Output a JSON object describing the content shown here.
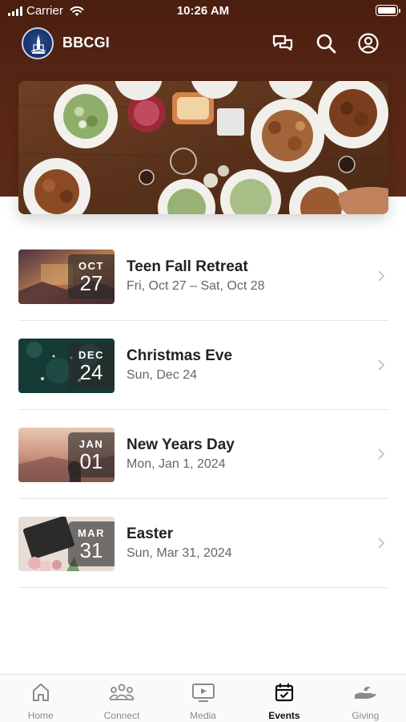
{
  "status_bar": {
    "carrier": "Carrier",
    "time": "10:26 AM"
  },
  "app_bar": {
    "title": "BBCGI"
  },
  "events": [
    {
      "month": "OCT",
      "day": "27",
      "title": "Teen Fall Retreat",
      "subtitle": "Fri, Oct 27 – Sat, Oct 28"
    },
    {
      "month": "DEC",
      "day": "24",
      "title": "Christmas Eve",
      "subtitle": "Sun, Dec 24"
    },
    {
      "month": "JAN",
      "day": "01",
      "title": "New Years Day",
      "subtitle": "Mon, Jan 1, 2024"
    },
    {
      "month": "MAR",
      "day": "31",
      "title": "Easter",
      "subtitle": "Sun, Mar 31, 2024"
    }
  ],
  "tabs": [
    {
      "label": "Home",
      "icon": "home-icon"
    },
    {
      "label": "Connect",
      "icon": "people-icon"
    },
    {
      "label": "Media",
      "icon": "media-icon"
    },
    {
      "label": "Events",
      "icon": "calendar-icon",
      "active": true
    },
    {
      "label": "Giving",
      "icon": "giving-hand-icon"
    }
  ],
  "colors": {
    "header_brown": "#5a2716",
    "active_tab": "#111111",
    "inactive_tab": "#8a8a8a"
  }
}
